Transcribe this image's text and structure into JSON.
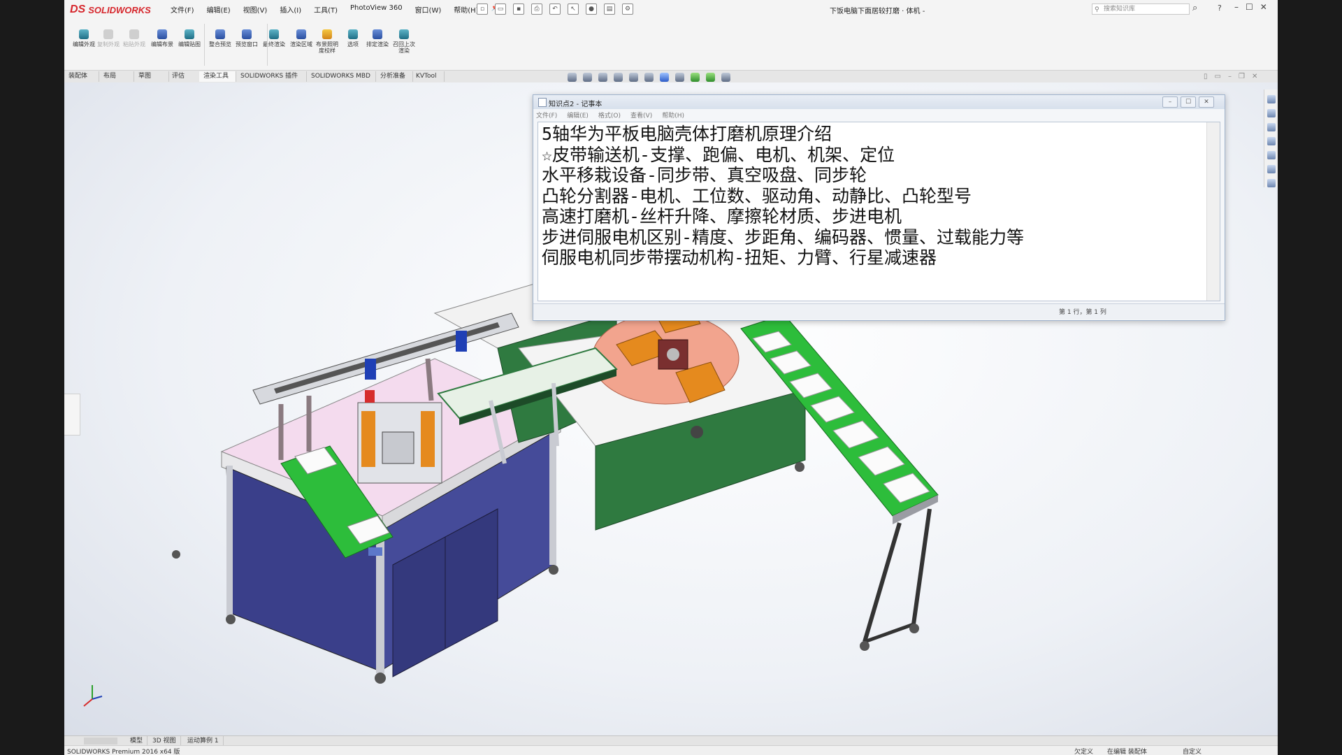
{
  "app": {
    "brand_ds": "DS",
    "brand_name": "SOLIDWORKS",
    "document_title": "下饭电脑下面居较打磨 · 体机 -",
    "search_placeholder": "搜索知识库"
  },
  "menu": [
    "文件(F)",
    "编辑(E)",
    "视图(V)",
    "插入(I)",
    "工具(T)",
    "PhotoView 360",
    "窗口(W)",
    "帮助(H)"
  ],
  "ribbon": {
    "buttons": [
      {
        "label": "编辑外观",
        "icon": "appearance-icon",
        "disabled": false
      },
      {
        "label": "复制外观",
        "icon": "copy-appearance-icon",
        "disabled": true
      },
      {
        "label": "粘贴外观",
        "icon": "paste-appearance-icon",
        "disabled": true
      },
      {
        "label": "编辑布景",
        "icon": "scene-icon",
        "disabled": false
      },
      {
        "label": "编辑贴图",
        "icon": "decal-icon",
        "disabled": false
      },
      {
        "label": "整合预览",
        "icon": "integrated-preview-icon",
        "disabled": false
      },
      {
        "label": "预览窗口",
        "icon": "preview-window-icon",
        "disabled": false
      },
      {
        "label": "最终渲染",
        "icon": "final-render-icon",
        "disabled": false
      },
      {
        "label": "渲染区域",
        "icon": "render-region-icon",
        "disabled": false
      },
      {
        "label": "布景照明度校样",
        "icon": "lighting-proofing-icon",
        "disabled": false
      },
      {
        "label": "选项",
        "icon": "options-icon",
        "disabled": false
      },
      {
        "label": "排定渲染",
        "icon": "schedule-render-icon",
        "disabled": false
      },
      {
        "label": "召回上次渲染",
        "icon": "recall-render-icon",
        "disabled": false
      }
    ]
  },
  "tabs": [
    "装配体",
    "布局",
    "草图",
    "评估",
    "渲染工具",
    "SOLIDWORKS 插件",
    "SOLIDWORKS MBD",
    "分析准备",
    "KVTool"
  ],
  "active_tab": "渲染工具",
  "notepad": {
    "title": "知识点2 - 记事本",
    "menu": [
      "文件(F)",
      "编辑(E)",
      "格式(O)",
      "查看(V)",
      "帮助(H)"
    ],
    "lines": [
      "5轴华为平板电脑壳体打磨机原理介绍",
      "☆皮带输送机-支撑、跑偏、电机、机架、定位",
      "水平移栽设备-同步带、真空吸盘、同步轮",
      "凸轮分割器-电机、工位数、驱动角、动静比、凸轮型号",
      "高速打磨机-丝杆升降、摩擦轮材质、步进电机",
      "步进伺服电机区别-精度、步距角、编码器、惯量、过载能力等",
      "伺服电机同步带摆动机构-扭矩、力臂、行星减速器"
    ],
    "status": "第 1 行，第 1 列"
  },
  "bottom_tabs": [
    "模型",
    "3D 视图",
    "运动算例 1"
  ],
  "statusbar": {
    "left": "SOLIDWORKS Premium 2016 x64 版",
    "right": [
      "欠定义",
      "在编辑 装配体",
      "自定义"
    ]
  },
  "colors": {
    "brand_red": "#d6262c",
    "belt_green": "#2dbd3b",
    "cabinet_blue": "#3a3f8a",
    "table_pink": "#f2dcec",
    "frame_green": "#2f7a40",
    "turntable_salmon": "#f2a48e",
    "fixture_orange": "#e58a1e"
  }
}
